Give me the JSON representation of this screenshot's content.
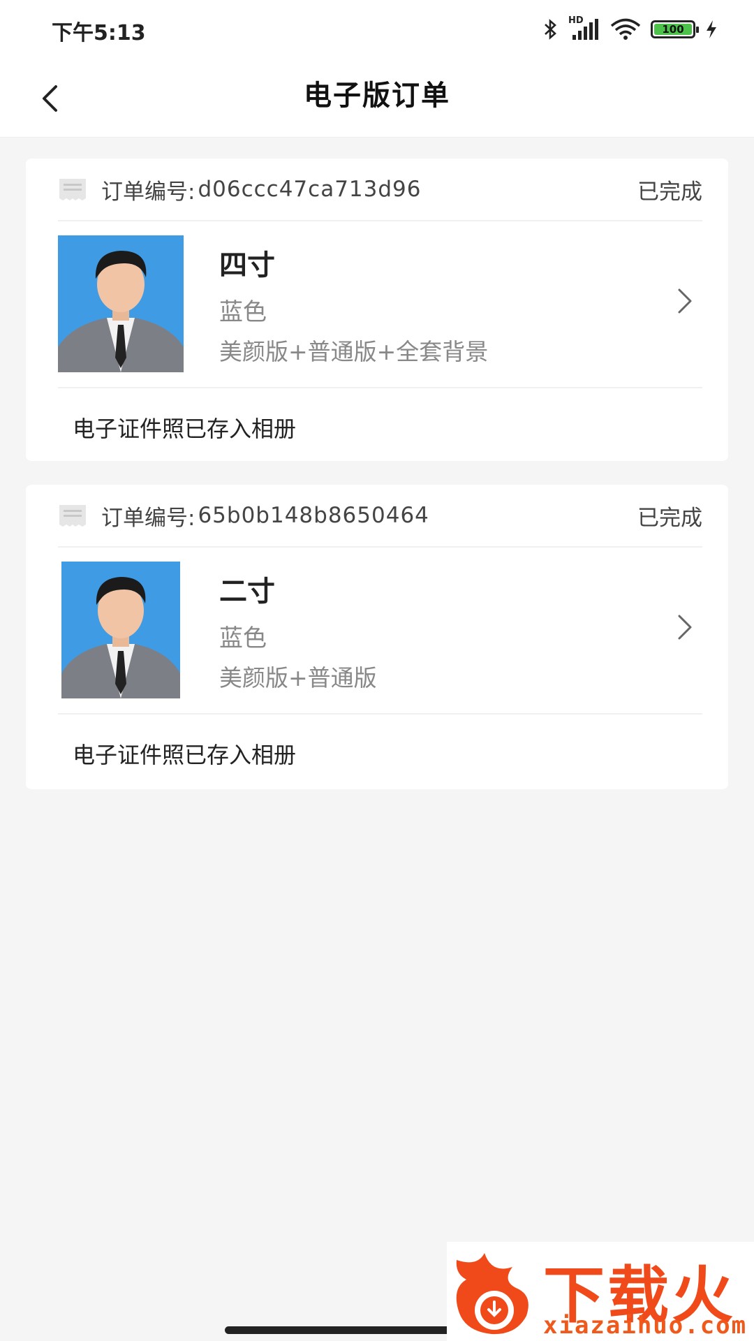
{
  "status_bar": {
    "time": "下午5:13",
    "network_label": "HD",
    "battery": "100",
    "icons": [
      "bluetooth-icon",
      "signal-icon",
      "wifi-icon",
      "battery-icon",
      "charging-icon"
    ]
  },
  "nav": {
    "title": "电子版订单",
    "back_icon": "chevron-left-icon"
  },
  "orders": [
    {
      "order_label": "订单编号:",
      "order_no": "d06ccc47ca713d96",
      "status": "已完成",
      "size": "四寸",
      "color": "蓝色",
      "desc": "美颜版+普通版+全套背景",
      "footer": "电子证件照已存入相册"
    },
    {
      "order_label": "订单编号:",
      "order_no": "65b0b148b8650464",
      "status": "已完成",
      "size": "二寸",
      "color": "蓝色",
      "desc": "美颜版+普通版",
      "footer": "电子证件照已存入相册"
    }
  ],
  "watermark": {
    "text": "下载火",
    "url": "xiazaihuo.com"
  },
  "colors": {
    "background": "#f5f5f5",
    "card": "#ffffff",
    "photo_bg": "#3f9be3",
    "watermark": "#f04a1a",
    "battery_fill": "#4cc24a"
  }
}
